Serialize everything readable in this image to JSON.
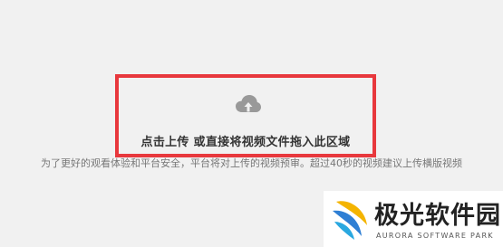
{
  "upload": {
    "label": "点击上传 或直接将视频文件拖入此区域",
    "icon": "cloud-upload-icon"
  },
  "notice": {
    "text": "为了更好的观看体验和平台安全，平台将对上传的视频预审。超过40秒的视频建议上传横版视频"
  },
  "watermark": {
    "name_cn": "极光软件园",
    "name_en": "AURORA SOFTWARE PARK",
    "icon": "aurora-logo-icon"
  },
  "colors": {
    "highlight_border": "#e8383d",
    "background": "#f1f1f1",
    "icon_gray": "#999999"
  }
}
